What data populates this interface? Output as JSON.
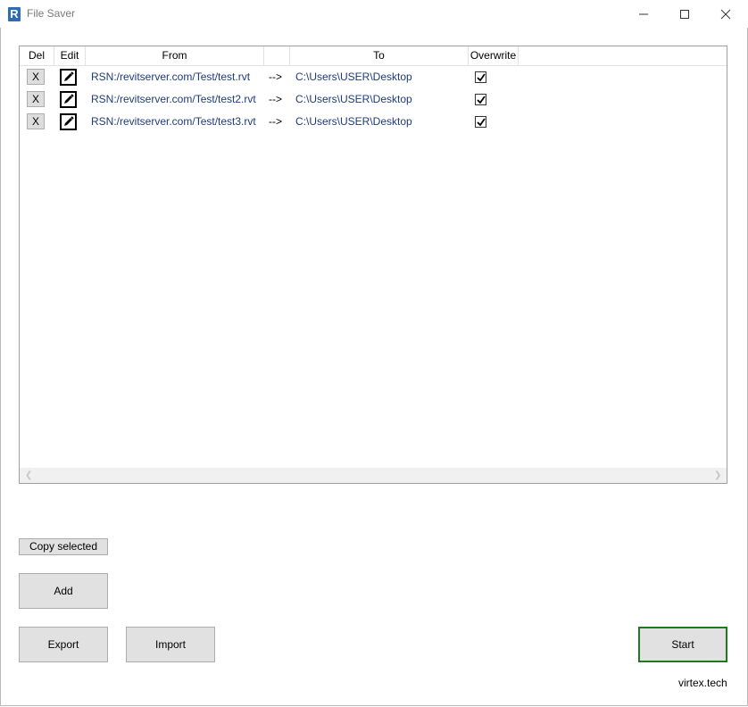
{
  "window": {
    "title": "File Saver",
    "icon_letter": "R",
    "icon_color": "#2d6db5"
  },
  "grid": {
    "columns": [
      "Del",
      "Edit",
      "From",
      "",
      "To",
      "Overwrite"
    ],
    "rows": [
      {
        "del": "X",
        "from": "RSN:/revitserver.com/Test/test.rvt",
        "arrow": "-->",
        "to": "C:\\Users\\USER\\Desktop",
        "overwrite": true
      },
      {
        "del": "X",
        "from": "RSN:/revitserver.com/Test/test2.rvt",
        "arrow": "-->",
        "to": "C:\\Users\\USER\\Desktop",
        "overwrite": true
      },
      {
        "del": "X",
        "from": "RSN:/revitserver.com/Test/test3.rvt",
        "arrow": "-->",
        "to": "C:\\Users\\USER\\Desktop",
        "overwrite": true
      }
    ]
  },
  "buttons": {
    "copy_selected": "Copy selected",
    "add": "Add",
    "export": "Export",
    "import": "Import",
    "start": "Start"
  },
  "footer": {
    "brand": "virtex.tech"
  },
  "colors": {
    "link_text": "#1e3c7a",
    "start_border": "#1f7a1f"
  }
}
